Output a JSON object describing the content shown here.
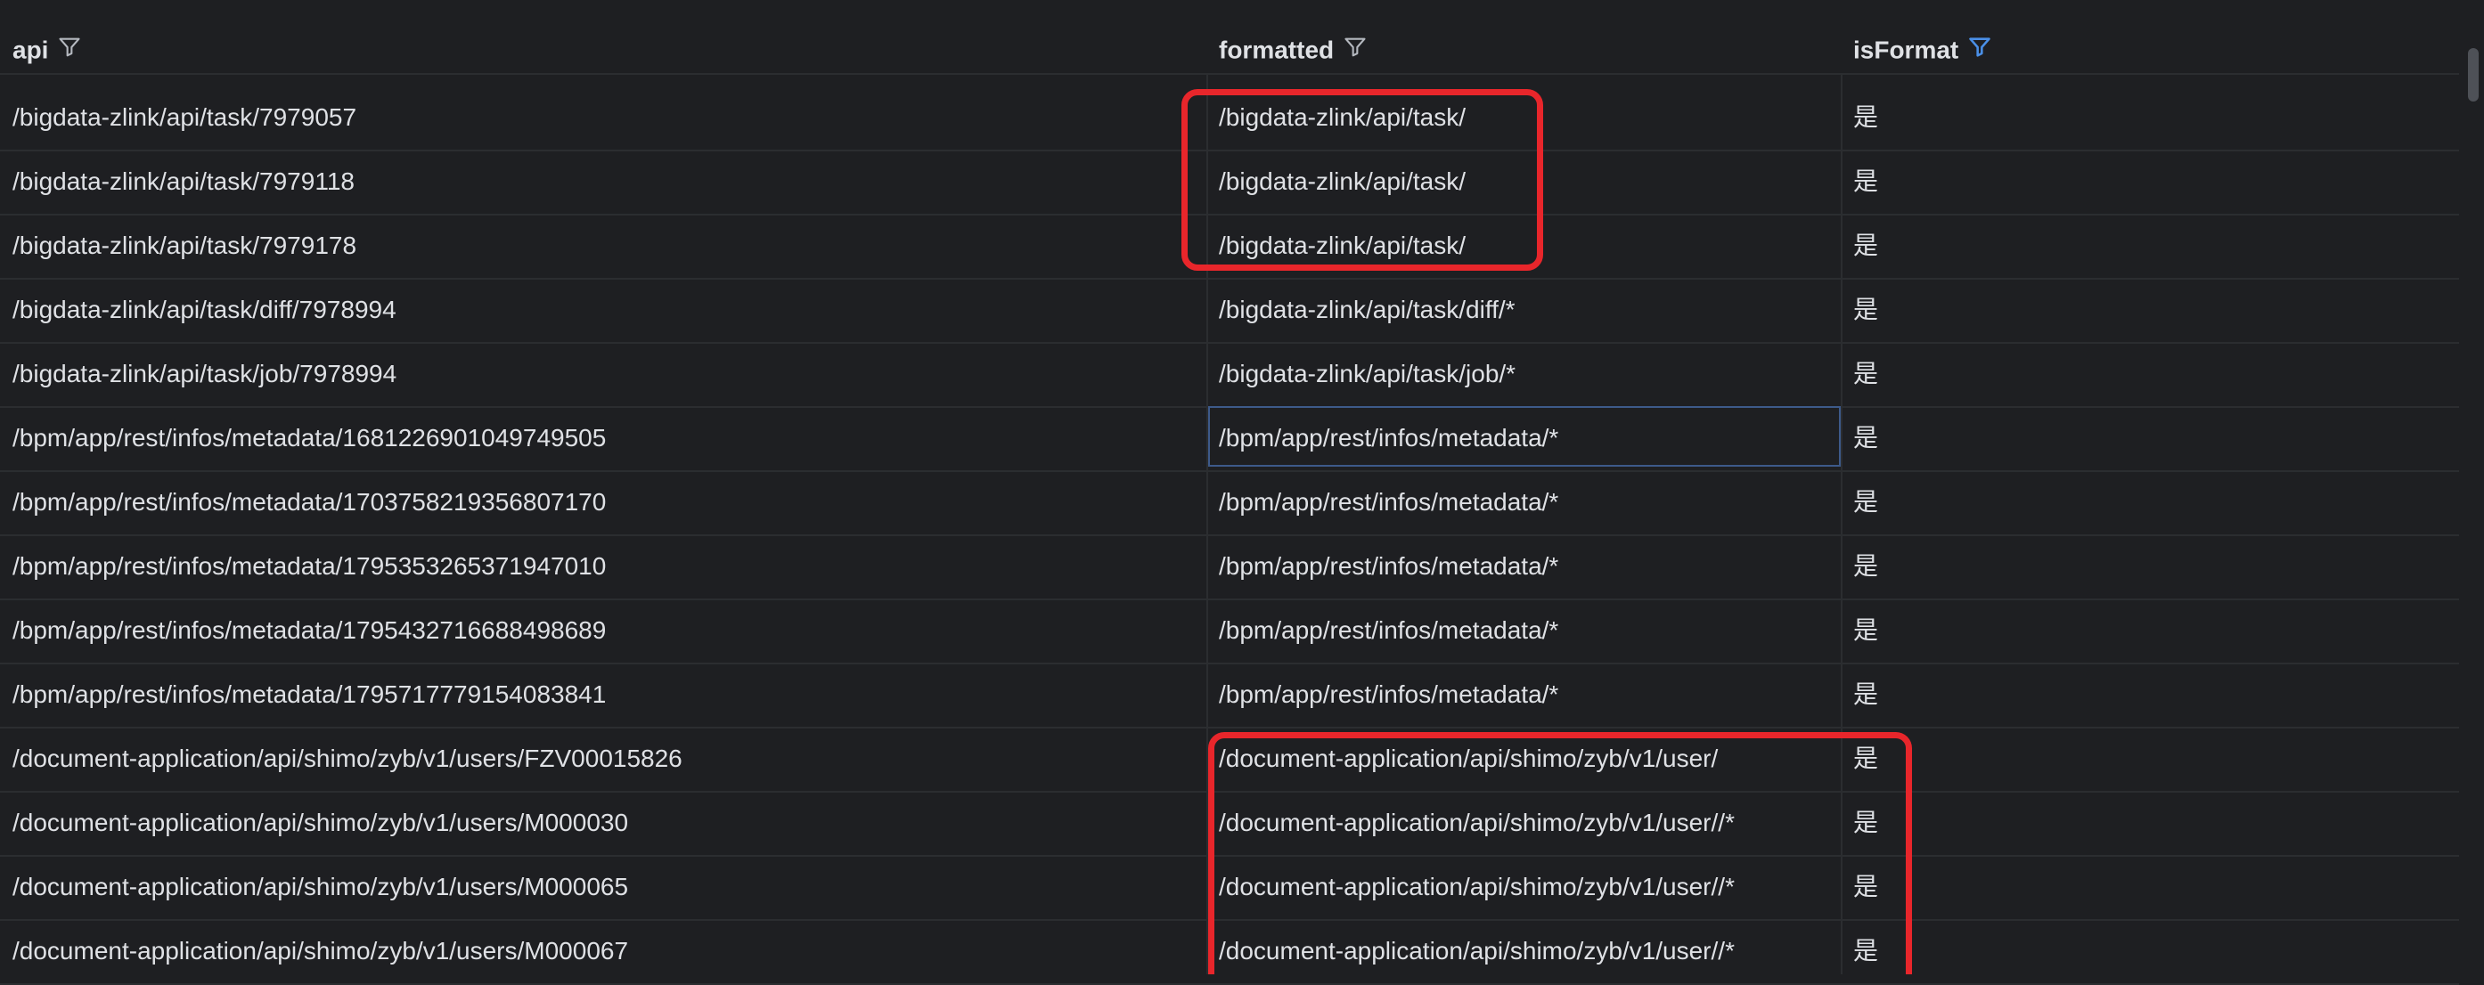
{
  "columns": [
    {
      "label": "api",
      "filter_active": false
    },
    {
      "label": "formatted",
      "filter_active": false
    },
    {
      "label": "isFormat",
      "filter_active": true
    }
  ],
  "colors": {
    "background": "#1e1f22",
    "text": "#dfe1e5",
    "grid": "#2b2d30",
    "highlight_box": "#e8262b",
    "active_filter": "#4a8fe7"
  },
  "rows": [
    {
      "api": "/bigdata-zlink/api/task/7979057",
      "formatted": "/bigdata-zlink/api/task/",
      "isFormat": "是"
    },
    {
      "api": "/bigdata-zlink/api/task/7979118",
      "formatted": "/bigdata-zlink/api/task/",
      "isFormat": "是"
    },
    {
      "api": "/bigdata-zlink/api/task/7979178",
      "formatted": "/bigdata-zlink/api/task/",
      "isFormat": "是"
    },
    {
      "api": "/bigdata-zlink/api/task/diff/7978994",
      "formatted": "/bigdata-zlink/api/task/diff/*",
      "isFormat": "是"
    },
    {
      "api": "/bigdata-zlink/api/task/job/7978994",
      "formatted": "/bigdata-zlink/api/task/job/*",
      "isFormat": "是"
    },
    {
      "api": "/bpm/app/rest/infos/metadata/1681226901049749505",
      "formatted": "/bpm/app/rest/infos/metadata/*",
      "isFormat": "是"
    },
    {
      "api": "/bpm/app/rest/infos/metadata/1703758219356807170",
      "formatted": "/bpm/app/rest/infos/metadata/*",
      "isFormat": "是"
    },
    {
      "api": "/bpm/app/rest/infos/metadata/1795353265371947010",
      "formatted": "/bpm/app/rest/infos/metadata/*",
      "isFormat": "是"
    },
    {
      "api": "/bpm/app/rest/infos/metadata/1795432716688498689",
      "formatted": "/bpm/app/rest/infos/metadata/*",
      "isFormat": "是"
    },
    {
      "api": "/bpm/app/rest/infos/metadata/1795717779154083841",
      "formatted": "/bpm/app/rest/infos/metadata/*",
      "isFormat": "是"
    },
    {
      "api": "/document-application/api/shimo/zyb/v1/users/FZV00015826",
      "formatted": "/document-application/api/shimo/zyb/v1/user/",
      "isFormat": "是"
    },
    {
      "api": "/document-application/api/shimo/zyb/v1/users/M000030",
      "formatted": "/document-application/api/shimo/zyb/v1/user//*",
      "isFormat": "是"
    },
    {
      "api": "/document-application/api/shimo/zyb/v1/users/M000065",
      "formatted": "/document-application/api/shimo/zyb/v1/user//*",
      "isFormat": "是"
    },
    {
      "api": "/document-application/api/shimo/zyb/v1/users/M000067",
      "formatted": "/document-application/api/shimo/zyb/v1/user//*",
      "isFormat": "是"
    }
  ]
}
